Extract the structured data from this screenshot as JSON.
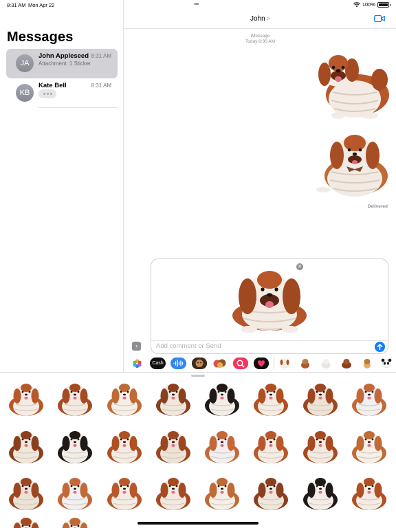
{
  "status": {
    "time": "8:31 AM",
    "date": "Mon Apr 22",
    "battery": "100%"
  },
  "sidebar": {
    "title": "Messages",
    "conversations": [
      {
        "initials": "JA",
        "name": "John Appleseed",
        "time": "8:31 AM",
        "preview": "Attachment: 1 Sticker",
        "selected": true
      },
      {
        "initials": "KB",
        "name": "Kate Bell",
        "time": "8:31 AM",
        "typing": true
      }
    ]
  },
  "chat": {
    "contact": "John",
    "service": "iMessage",
    "timestamp": "Today 8:30 AM",
    "delivered": "Delivered"
  },
  "compose": {
    "placeholder": "Add comment or Send"
  },
  "apps": [
    {
      "name": "photos-app"
    },
    {
      "name": "apple-cash-app",
      "label": "Cash"
    },
    {
      "name": "audio-message-app"
    },
    {
      "name": "memoji-app"
    },
    {
      "name": "memoji-stickers-app"
    },
    {
      "name": "image-search-app"
    },
    {
      "name": "digital-touch-app"
    }
  ],
  "colors": {
    "accent": "#147efb",
    "selected_row": "#d1d1d6",
    "dog_brown": "#b8582a",
    "dog_white": "#f4ece4"
  }
}
